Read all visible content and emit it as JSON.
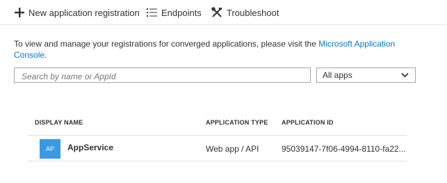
{
  "toolbar": {
    "new_registration": "New application registration",
    "endpoints": "Endpoints",
    "troubleshoot": "Troubleshoot"
  },
  "intro": {
    "text": "To view and manage your registrations for converged applications, please visit the ",
    "link": "Microsoft Application Console",
    "suffix": "."
  },
  "search": {
    "placeholder": "Search by name or AppId",
    "value": ""
  },
  "filter": {
    "selected": "All apps"
  },
  "table": {
    "columns": [
      "DISPLAY NAME",
      "APPLICATION TYPE",
      "APPLICATION ID"
    ],
    "rows": [
      {
        "initials": "AP",
        "name": "AppService",
        "type": "Web app / API",
        "id": "95039147-7f06-4994-8110-fa22..."
      }
    ]
  },
  "colors": {
    "link": "#0078d4",
    "avatar": "#3999e3",
    "text": "#323130"
  }
}
